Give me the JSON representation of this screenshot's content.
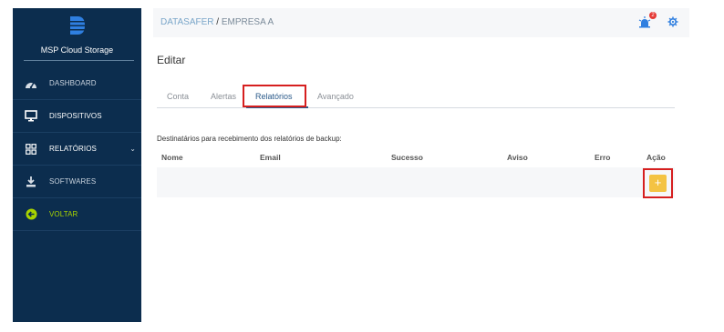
{
  "sidebar": {
    "brand": "MSP Cloud Storage",
    "items": [
      {
        "label": "DASHBOARD",
        "icon": "gauge-icon"
      },
      {
        "label": "DISPOSITIVOS",
        "icon": "monitor-icon"
      },
      {
        "label": "RELATÓRIOS",
        "icon": "grid-icon",
        "chevron": "⌄"
      },
      {
        "label": "SOFTWARES",
        "icon": "download-icon"
      },
      {
        "label": "VOLTAR",
        "icon": "back-arrow-icon"
      }
    ]
  },
  "header": {
    "crumb_primary": "DATASAFER",
    "crumb_separator": " / ",
    "crumb_secondary": "EMPRESA A",
    "notification_count": "2"
  },
  "page": {
    "title": "Editar",
    "tabs": [
      {
        "label": "Conta"
      },
      {
        "label": "Alertas"
      },
      {
        "label": "Relatórios"
      },
      {
        "label": "Avançado"
      }
    ],
    "description": "Destinatários para recebimento dos relatórios de backup:",
    "table": {
      "columns": [
        "Nome",
        "Email",
        "Sucesso",
        "Aviso",
        "Erro",
        "Ação"
      ]
    },
    "add_button": "+"
  },
  "colors": {
    "sidebar_bg": "#0c2d4e",
    "accent": "#2b5a8a",
    "back_green": "#a8d300",
    "add_yellow": "#f4c343",
    "highlight_red": "#d61f1f"
  }
}
